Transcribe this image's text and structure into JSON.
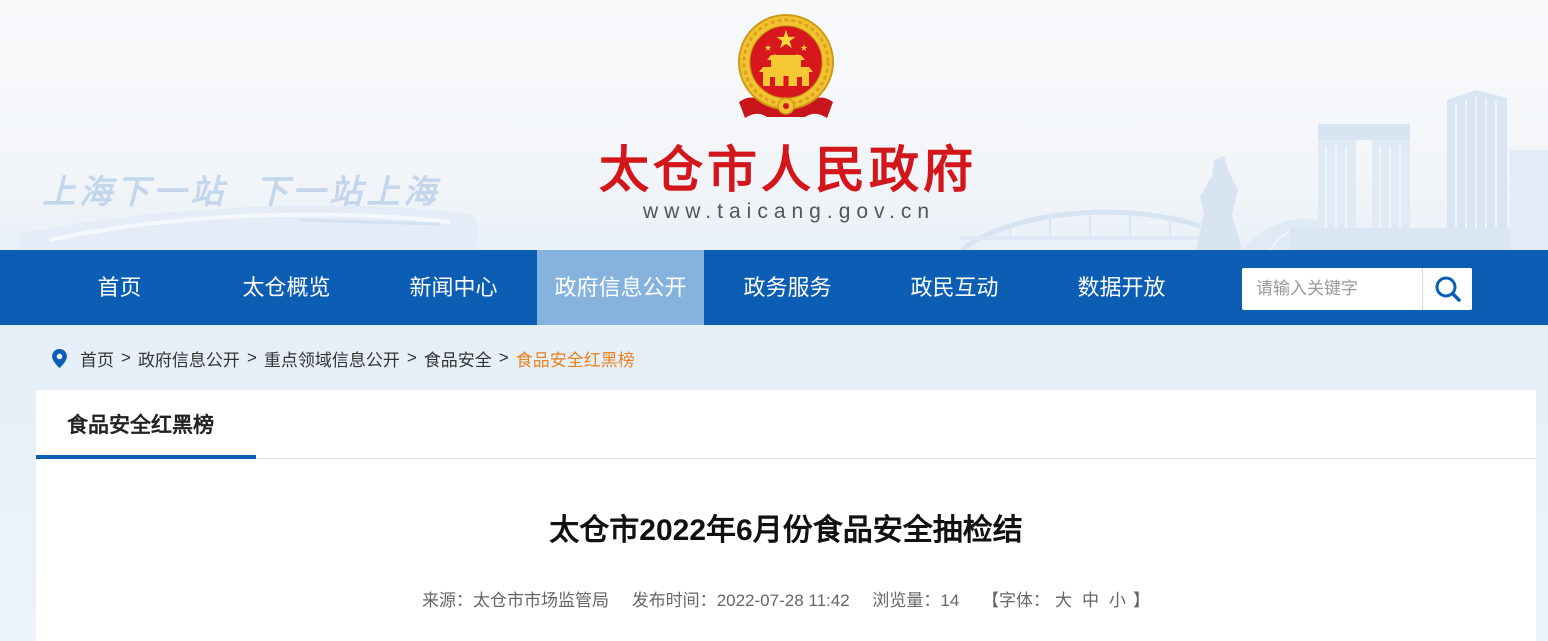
{
  "header": {
    "slogan": [
      "上海下一站",
      "下一站上海"
    ],
    "emblem_icon": "national-emblem-icon",
    "site_title": "太仓市人民政府",
    "site_url": "www.taicang.gov.cn"
  },
  "nav": {
    "items": [
      {
        "label": "首页",
        "active": false
      },
      {
        "label": "太仓概览",
        "active": false
      },
      {
        "label": "新闻中心",
        "active": false
      },
      {
        "label": "政府信息公开",
        "active": true
      },
      {
        "label": "政务服务",
        "active": false
      },
      {
        "label": "政民互动",
        "active": false
      },
      {
        "label": "数据开放",
        "active": false
      }
    ],
    "search": {
      "placeholder": "请输入关键字",
      "value": "",
      "button_icon": "search-icon"
    }
  },
  "breadcrumb": {
    "icon": "location-pin-icon",
    "separator": ">",
    "items": [
      "首页",
      "政府信息公开",
      "重点领域信息公开",
      "食品安全",
      "食品安全红黑榜"
    ]
  },
  "section": {
    "tab_title": "食品安全红黑榜"
  },
  "article": {
    "title": "太仓市2022年6月份食品安全抽检结",
    "meta": {
      "source_label": "来源：",
      "source": "太仓市市场监管局",
      "publish_label": "发布时间：",
      "publish_time": "2022-07-28 11:42",
      "views_label": "浏览量：",
      "views": "14",
      "font_label": "【字体：",
      "font_sizes": [
        "大",
        "中",
        "小"
      ],
      "font_close": "】"
    }
  },
  "colors": {
    "nav_bg": "#0c5db4",
    "nav_active_bg": "#86b3de",
    "site_title": "#d3161c",
    "breadcrumb_current": "#e8821f",
    "tab_underline": "#0c5db4"
  }
}
